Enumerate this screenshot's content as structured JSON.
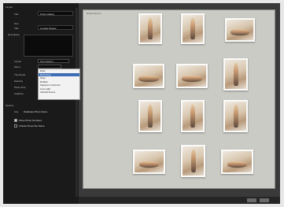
{
  "sidebar": {
    "sections": [
      {
        "label": "Layout"
      },
      {
        "label": "Options"
      }
    ],
    "title_field": {
      "label": "Title",
      "value": "Photo Gallery"
    },
    "text_label": "Text",
    "subtitle_field": {
      "label": "Title",
      "value": "Contact Sheets"
    },
    "description_label": "Description",
    "layout_field": {
      "label": "Layout",
      "value": "Two Column"
    },
    "menu_field_label": "Menu",
    "dropdown": {
      "items": [
        "Dark",
        "Dark Gray",
        "Gray",
        "Default",
        "Squares 3 columns",
        "Line Light",
        "Vertical Frame"
      ],
      "selected_index": 1
    },
    "rows": [
      {
        "label": "Thumbnail"
      },
      {
        "label": "Spacing"
      },
      {
        "label": "Photo Size"
      },
      {
        "label": "Captions"
      }
    ],
    "options_label": "Options",
    "title_type": "Use",
    "title_select": "Database Photo Name",
    "checks": [
      {
        "label": "Show Photo Numbers",
        "checked": true
      },
      {
        "label": "Include Photo File Name",
        "checked": false
      }
    ]
  },
  "canvas": {
    "title": "Bridal Season"
  },
  "thumbs": [
    {
      "orient": "portrait"
    },
    {
      "orient": "portrait"
    },
    {
      "orient": "landscape"
    },
    {
      "orient": "landscape"
    },
    {
      "orient": "landscape"
    },
    {
      "orient": "portrait"
    },
    {
      "orient": "portrait"
    },
    {
      "orient": "portrait"
    },
    {
      "orient": "portrait"
    },
    {
      "orient": "landscape"
    },
    {
      "orient": "portrait"
    },
    {
      "orient": "landscape"
    }
  ],
  "colors": {
    "panel": "#1a1a1a",
    "canvas": "#cbcbc6",
    "selection": "#3d6db5"
  }
}
